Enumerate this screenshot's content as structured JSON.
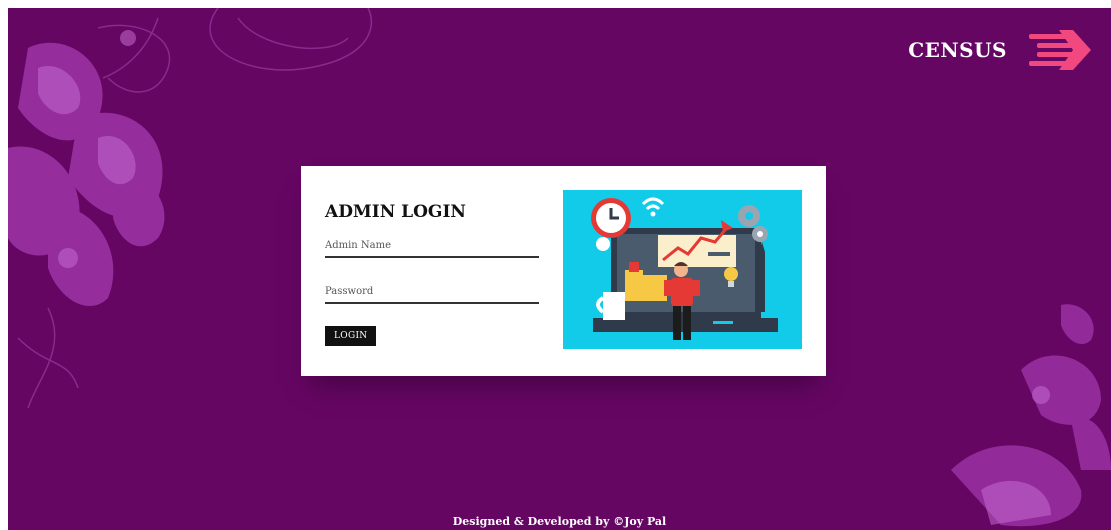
{
  "brand": {
    "name": "CENSUS",
    "logo_icon": "speed-arrow-icon",
    "logo_color": "#f0487f"
  },
  "login": {
    "title": "ADMIN LOGIN",
    "admin_name_placeholder": "Admin Name",
    "password_placeholder": "Password",
    "button_label": "LOGIN",
    "illustration": "computer-work-illustration"
  },
  "footer": {
    "text": "Designed & Developed by ©Joy Pal"
  },
  "colors": {
    "background": "#650663",
    "card": "#ffffff",
    "illustration_bg": "#12cbe8",
    "button": "#111111"
  }
}
